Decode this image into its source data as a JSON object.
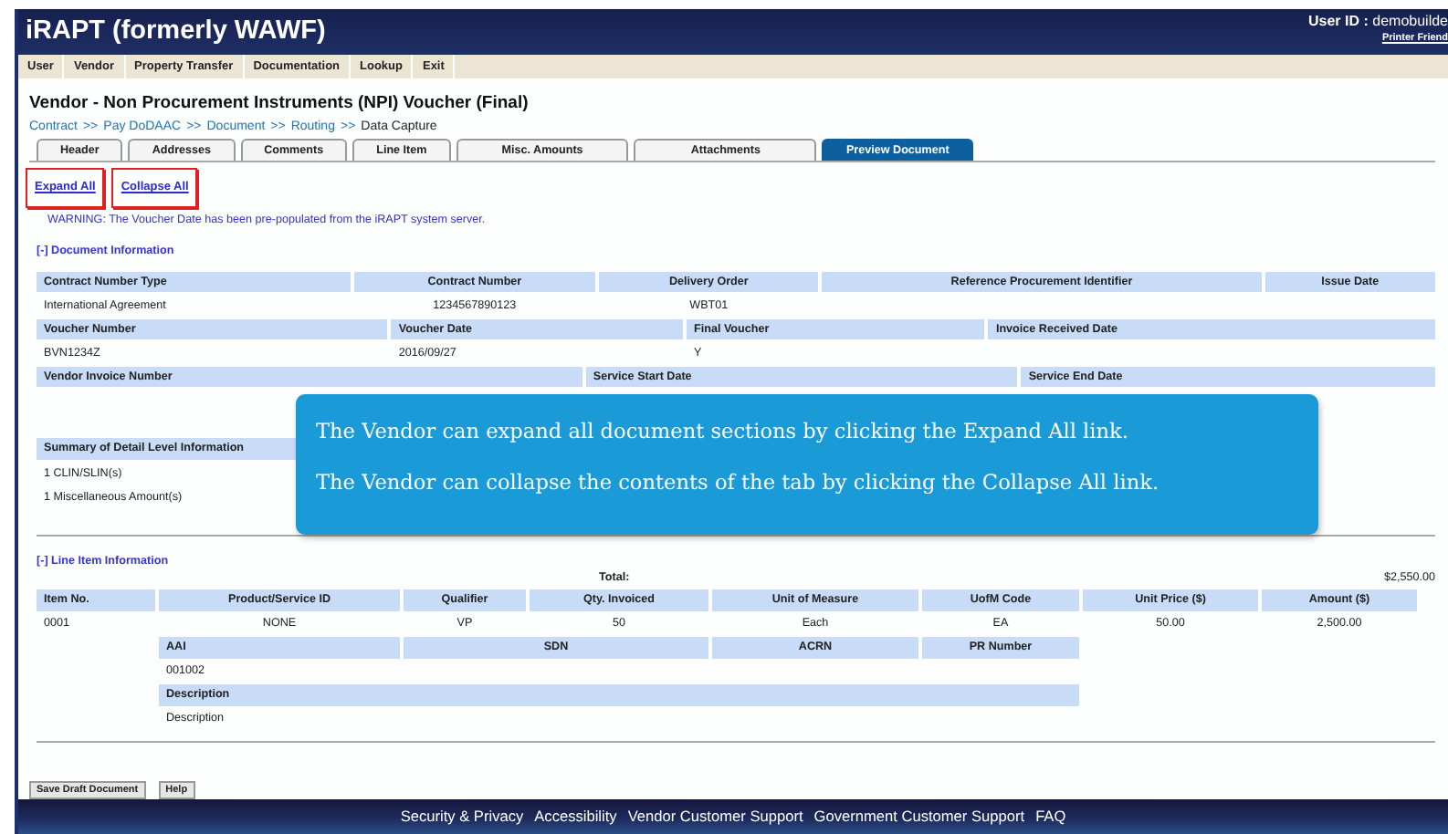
{
  "header": {
    "title": "iRAPT (formerly WAWF)",
    "user_id_label": "User ID :",
    "user_id": "demobuilde",
    "printer_link": "Printer Friend"
  },
  "menu": [
    "User",
    "Vendor",
    "Property Transfer",
    "Documentation",
    "Lookup",
    "Exit"
  ],
  "page_title": "Vendor - Non Procurement Instruments (NPI) Voucher (Final)",
  "breadcrumb": [
    {
      "label": "Contract",
      "link": true
    },
    {
      "label": "Pay DoDAAC",
      "link": true
    },
    {
      "label": "Document",
      "link": true
    },
    {
      "label": "Routing",
      "link": true
    },
    {
      "label": "Data Capture",
      "link": false
    }
  ],
  "breadcrumb_separator": ">>",
  "tabs": [
    {
      "label": "Header",
      "selected": false
    },
    {
      "label": "Addresses",
      "selected": false
    },
    {
      "label": "Comments",
      "selected": false
    },
    {
      "label": "Line Item",
      "selected": false
    },
    {
      "label": "Misc. Amounts",
      "selected": false
    },
    {
      "label": "Attachments",
      "selected": false
    },
    {
      "label": "Preview Document",
      "selected": true
    }
  ],
  "actions": [
    {
      "label": "Expand All",
      "highlighted": true
    },
    {
      "label": "Collapse All",
      "highlighted": true
    }
  ],
  "warning": "WARNING: The Voucher Date has been pre-populated from the iRAPT system server.",
  "document_info": {
    "toggle": "[-] Document Information",
    "rows": [
      {
        "headers": [
          "Contract Number Type",
          "Contract Number",
          "Delivery Order",
          "Reference Procurement Identifier",
          "Issue Date"
        ],
        "values": [
          "International Agreement",
          "1234567890123",
          "WBT01"
        ]
      },
      {
        "headers": [
          "Voucher Number",
          "Voucher Date",
          "Final Voucher",
          "Invoice Received Date"
        ],
        "values": [
          "BVN1234Z",
          "2016/09/27",
          "Y"
        ]
      },
      {
        "headers": [
          "Vendor Invoice Number",
          "Service Start Date",
          "Service End Date"
        ]
      }
    ]
  },
  "summary": {
    "header": "Summary of Detail Level Information",
    "values": [
      "1 CLIN/SLIN(s)",
      "1 Miscellaneous Amount(s)"
    ]
  },
  "callout": {
    "lines": [
      "The Vendor can expand all document sections by clicking the Expand All link.",
      "The Vendor can collapse the contents of the tab by clicking the Collapse All link."
    ]
  },
  "line_items": {
    "toggle": "[-] Line Item Information",
    "total_label": "Total:",
    "total": "$2,550.00",
    "columns": [
      "Item No.",
      "Product/Service ID",
      "Qualifier",
      "Qty. Invoiced",
      "Unit of Measure",
      "UofM Code",
      "Unit Price ($)",
      "Amount ($)"
    ],
    "row": [
      "0001",
      "NONE",
      "VP",
      "50",
      "Each",
      "EA",
      "50.00",
      "2,500.00"
    ],
    "sub_headers": [
      "AAI",
      "SDN",
      "ACRN",
      "PR Number"
    ],
    "sub_values": [
      "001002"
    ],
    "description_header": "Description",
    "description_value": "Description"
  },
  "buttons": [
    "Save Draft Document",
    "Help"
  ],
  "footer": [
    "Security & Privacy",
    "Accessibility",
    "Vendor Customer Support",
    "Government Customer Support",
    "FAQ"
  ]
}
